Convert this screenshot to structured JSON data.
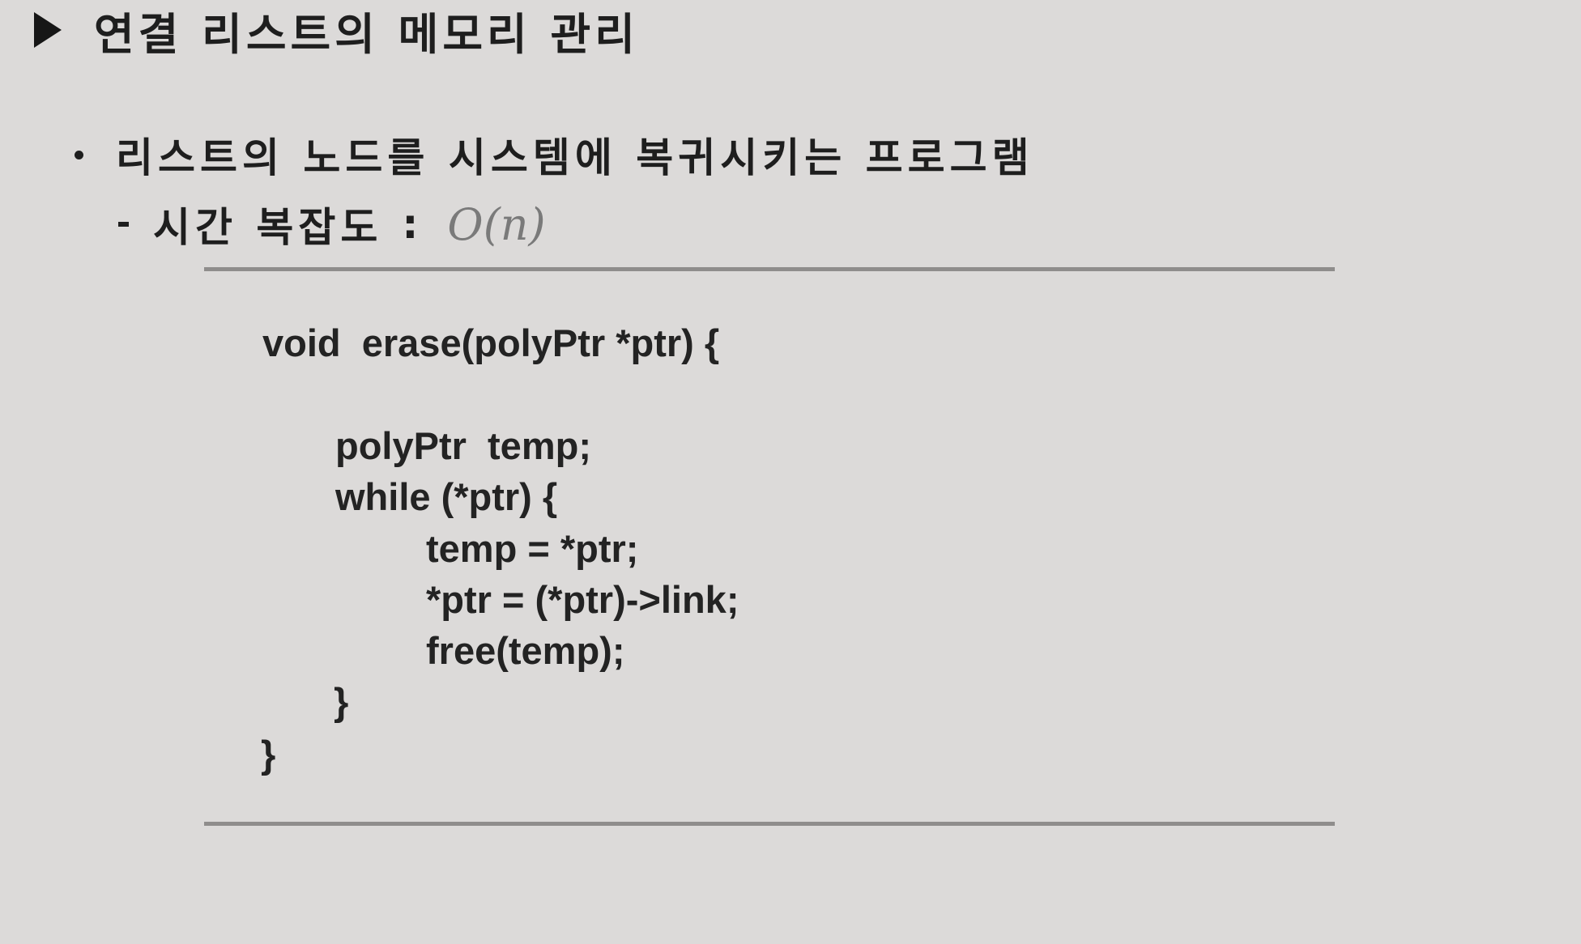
{
  "heading": {
    "text": "연결 리스트의 메모리 관리"
  },
  "bullet": {
    "text": "리스트의 노드를 시스템에 복귀시키는 프로그램"
  },
  "complexity": {
    "label": "시간 복잡도",
    "separator": ":",
    "value": "O(n)"
  },
  "code": {
    "lines": [
      "void  erase(polyPtr *ptr) {",
      "polyPtr  temp;",
      "while (*ptr) {",
      "temp = *ptr;",
      "*ptr = (*ptr)->link;",
      "free(temp);",
      "}",
      "}"
    ]
  }
}
